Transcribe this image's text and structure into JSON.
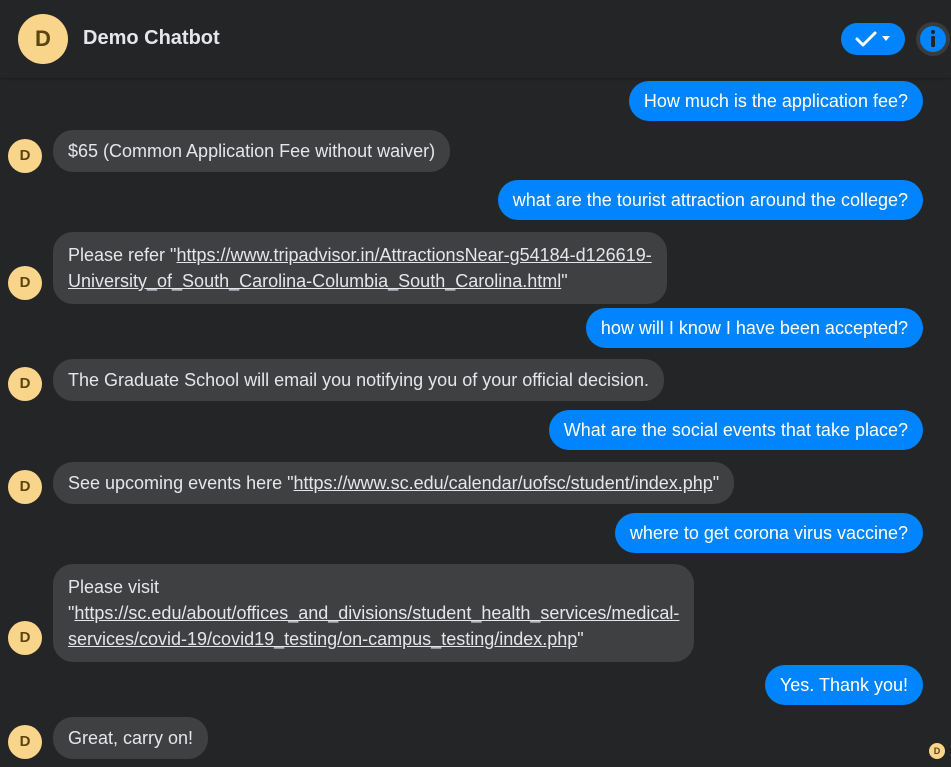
{
  "header": {
    "avatar_letter": "D",
    "title": "Demo Chatbot"
  },
  "colors": {
    "background": "#242526",
    "accent": "#0084ff",
    "bot_bubble": "#3e4042",
    "avatar": "#f9d58b"
  },
  "messages": [
    {
      "sender": "user",
      "text": "How much is the application fee?"
    },
    {
      "sender": "bot",
      "text": "$65 (Common Application Fee without waiver)"
    },
    {
      "sender": "user",
      "text": "what are the tourist attraction around the college?"
    },
    {
      "sender": "bot",
      "prefix": "Please refer \"",
      "link_line1": "https://www.tripadvisor.in/AttractionsNear-g54184-d126619-",
      "link_line2": "University_of_South_Carolina-Columbia_South_Carolina.html",
      "suffix": "\""
    },
    {
      "sender": "user",
      "text": "how will I know I have been accepted?"
    },
    {
      "sender": "bot",
      "text": "The Graduate School will email you notifying you of your official decision."
    },
    {
      "sender": "user",
      "text": "What are the social events that take place?"
    },
    {
      "sender": "bot",
      "prefix": "See upcoming events here \"",
      "link": "https://www.sc.edu/calendar/uofsc/student/index.php",
      "suffix": "\""
    },
    {
      "sender": "user",
      "text": "where to get corona virus vaccine?"
    },
    {
      "sender": "bot",
      "prefix": "Please visit",
      "prefix2": "\"",
      "link_line1": "https://sc.edu/about/offices_and_divisions/student_health_services/medical-",
      "link_line2": "services/covid-19/covid19_testing/on-campus_testing/index.php",
      "suffix": "\""
    },
    {
      "sender": "user",
      "text": "Yes. Thank you!"
    },
    {
      "sender": "bot",
      "text": "Great, carry on!"
    }
  ],
  "bot_avatar_letter": "D",
  "read_receipt_letter": "D"
}
